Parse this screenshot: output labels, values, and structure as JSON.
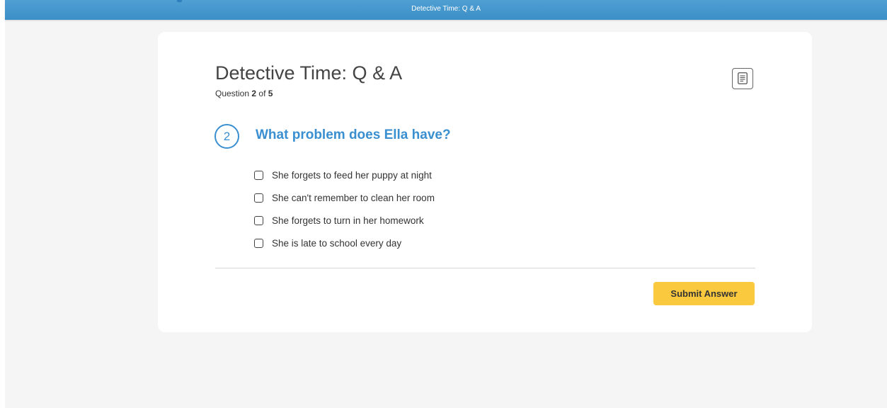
{
  "header": {
    "title": "Detective Time: Q & A"
  },
  "quiz": {
    "title": "Detective Time: Q & A",
    "progress": {
      "prefix": "Question",
      "current": "2",
      "separator": "of",
      "total": "5"
    },
    "question": {
      "number": "2",
      "text": "What problem does Ella have?",
      "options": [
        {
          "label": "She forgets to feed her puppy at night",
          "checked": false
        },
        {
          "label": "She can't remember to clean her room",
          "checked": false
        },
        {
          "label": "She forgets to turn in her homework",
          "checked": false
        },
        {
          "label": "She is late to school every day",
          "checked": false
        }
      ]
    },
    "submit_label": "Submit Answer"
  },
  "icons": {
    "reading_passage": "document-icon"
  },
  "colors": {
    "accent": "#3a8fd0",
    "header_bar": "#4098cd",
    "submit": "#fbc93d",
    "background": "#f5f5f5"
  }
}
